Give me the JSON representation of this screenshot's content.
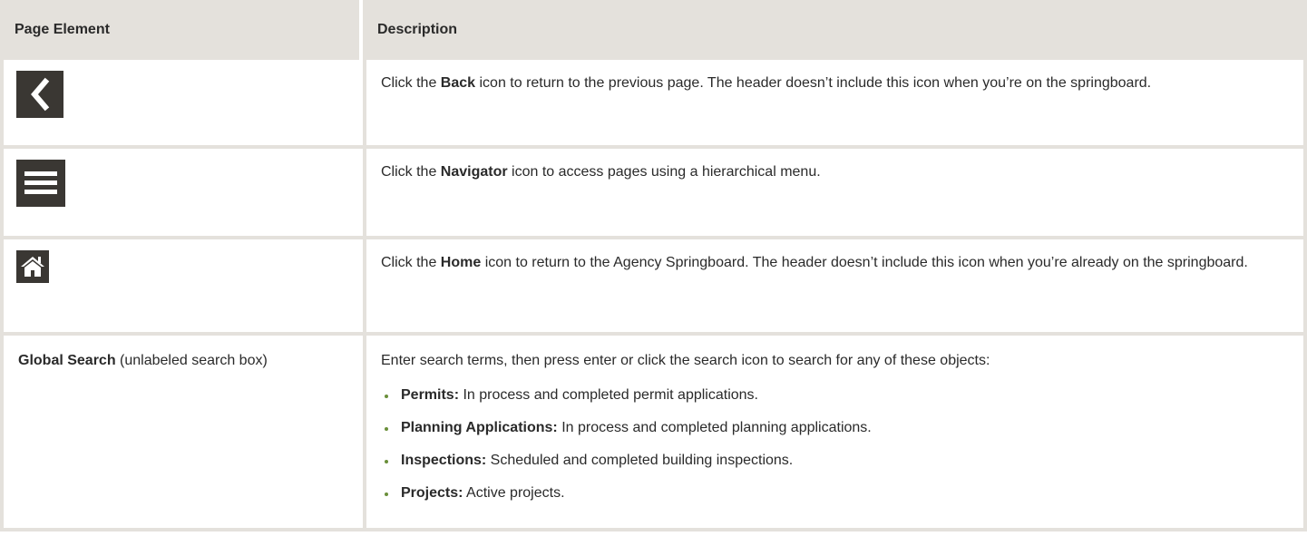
{
  "table": {
    "headers": [
      "Page Element",
      "Description"
    ],
    "rows": [
      {
        "icon": "back-icon",
        "desc_pre": "Click the ",
        "desc_bold": "Back",
        "desc_post": " icon to return to the previous page. The header doesn’t include this icon when you’re on the springboard."
      },
      {
        "icon": "navigator-icon",
        "desc_pre": "Click the ",
        "desc_bold": "Navigator",
        "desc_post": " icon to access pages using a hierarchical menu."
      },
      {
        "icon": "home-icon",
        "desc_pre": "Click the ",
        "desc_bold": "Home",
        "desc_post": " icon to return to the Agency Springboard. The header doesn’t include this icon when you’re already on the springboard."
      },
      {
        "element_bold": "Global Search",
        "element_rest": " (unlabeled search box)",
        "desc_intro": "Enter search terms, then press enter or click the search icon to search for any of these objects:",
        "bullets": [
          {
            "term": "Permits:",
            "text": " In process and completed permit applications."
          },
          {
            "term": "Planning Applications:",
            "text": " In process and completed planning applications."
          },
          {
            "term": "Inspections:",
            "text": " Scheduled and completed building inspections."
          },
          {
            "term": "Projects:",
            "text": " Active projects."
          }
        ]
      }
    ]
  },
  "colors": {
    "header_bg": "#e4e1dc",
    "icon_bg": "#3a3733",
    "bullet": "#6a8f3a"
  }
}
